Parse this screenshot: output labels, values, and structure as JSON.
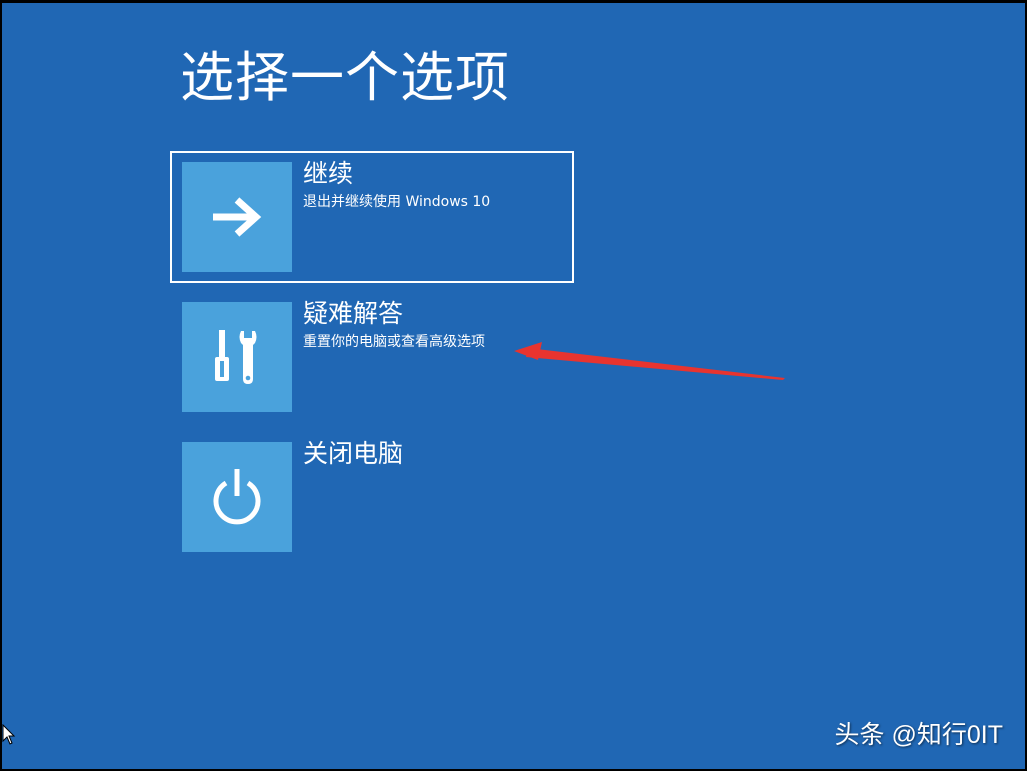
{
  "title": "选择一个选项",
  "options": [
    {
      "label": "继续",
      "description": "退出并继续使用 Windows 10",
      "icon": "arrow-right-icon",
      "selected": true
    },
    {
      "label": "疑难解答",
      "description": "重置你的电脑或查看高级选项",
      "icon": "tools-icon",
      "selected": false
    },
    {
      "label": "关闭电脑",
      "description": "",
      "icon": "power-icon",
      "selected": false
    }
  ],
  "watermark": "头条 @知行0IT",
  "colors": {
    "background": "#2067b4",
    "tile": "#4aa2dc",
    "arrow_annotation": "#e8342f"
  }
}
